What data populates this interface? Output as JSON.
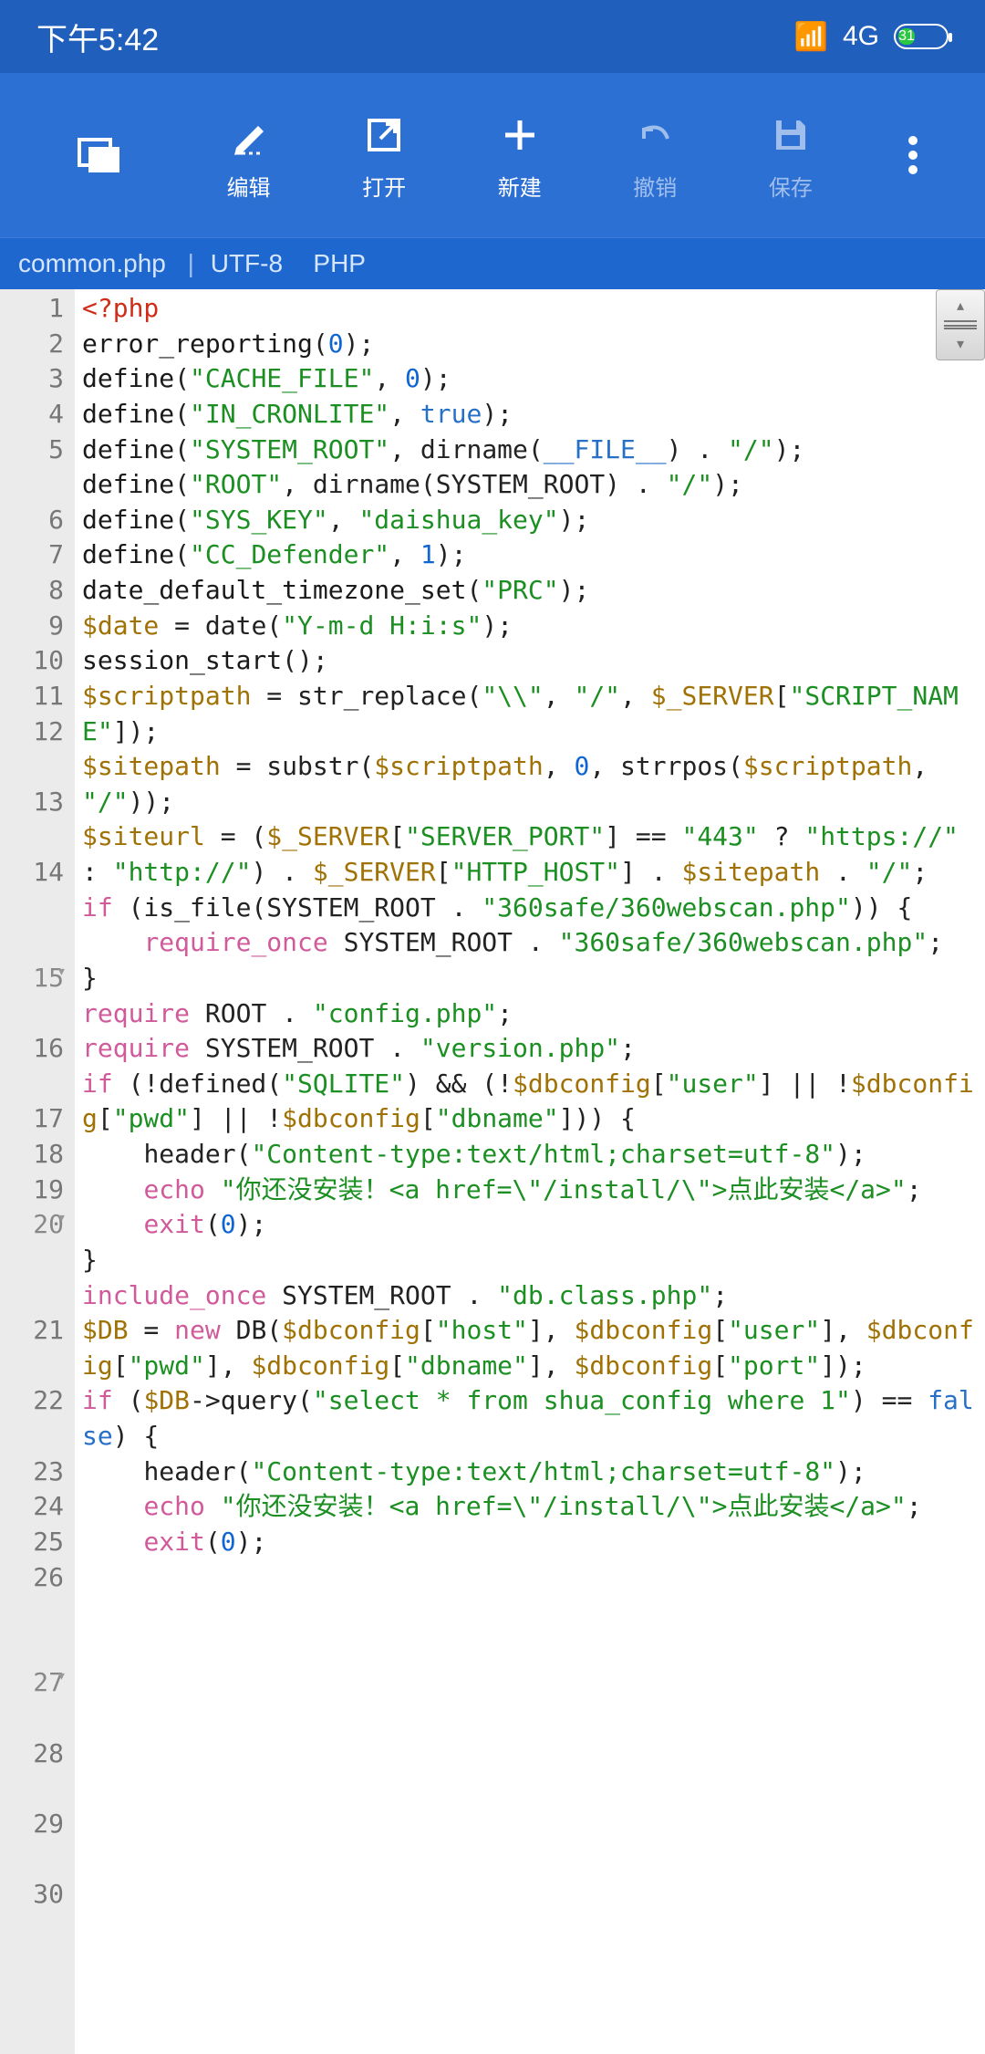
{
  "status": {
    "time": "下午5:42",
    "network": "4G",
    "battery_pct": "31"
  },
  "toolbar": {
    "edit": "编辑",
    "open": "打开",
    "new": "新建",
    "undo": "撤销",
    "save": "保存"
  },
  "filebar": {
    "filename": "common.php",
    "encoding": "UTF-8",
    "lang": "PHP"
  },
  "gutter_lines": [
    "1",
    "2",
    "3",
    "4",
    "5",
    "",
    "6",
    "7",
    "8",
    "9",
    "10",
    "11",
    "12",
    "",
    "13",
    "",
    "14",
    "",
    "",
    "15",
    "",
    "16",
    "",
    "17",
    "18",
    "19",
    "20",
    "",
    "",
    "21",
    "",
    "22",
    "",
    "23",
    "24",
    "25",
    "26",
    "",
    "",
    "27",
    "",
    "28",
    "",
    "29",
    "",
    "30"
  ],
  "fold_lines": [
    "15",
    "20",
    "27"
  ],
  "code_tokens": [
    [
      {
        "c": "tag",
        "t": "<?php"
      }
    ],
    [
      {
        "c": "fn",
        "t": "error_reporting"
      },
      {
        "c": "punc",
        "t": "("
      },
      {
        "c": "num",
        "t": "0"
      },
      {
        "c": "punc",
        "t": ");"
      }
    ],
    [
      {
        "c": "fn",
        "t": "define"
      },
      {
        "c": "punc",
        "t": "("
      },
      {
        "c": "str",
        "t": "\"CACHE_FILE\""
      },
      {
        "c": "punc",
        "t": ", "
      },
      {
        "c": "num",
        "t": "0"
      },
      {
        "c": "punc",
        "t": ");"
      }
    ],
    [
      {
        "c": "fn",
        "t": "define"
      },
      {
        "c": "punc",
        "t": "("
      },
      {
        "c": "str",
        "t": "\"IN_CRONLITE\""
      },
      {
        "c": "punc",
        "t": ", "
      },
      {
        "c": "bool",
        "t": "true"
      },
      {
        "c": "punc",
        "t": ");"
      }
    ],
    [
      {
        "c": "fn",
        "t": "define"
      },
      {
        "c": "punc",
        "t": "("
      },
      {
        "c": "str",
        "t": "\"SYSTEM_ROOT\""
      },
      {
        "c": "punc",
        "t": ", dirname("
      },
      {
        "c": "def",
        "t": "__FILE__"
      },
      {
        "c": "punc",
        "t": ") . "
      },
      {
        "c": "str",
        "t": "\"/\""
      },
      {
        "c": "punc",
        "t": ");"
      }
    ],
    [
      {
        "c": "fn",
        "t": "define"
      },
      {
        "c": "punc",
        "t": "("
      },
      {
        "c": "str",
        "t": "\"ROOT\""
      },
      {
        "c": "punc",
        "t": ", dirname(SYSTEM_ROOT) . "
      },
      {
        "c": "str",
        "t": "\"/\""
      },
      {
        "c": "punc",
        "t": ");"
      }
    ],
    [
      {
        "c": "fn",
        "t": "define"
      },
      {
        "c": "punc",
        "t": "("
      },
      {
        "c": "str",
        "t": "\"SYS_KEY\""
      },
      {
        "c": "punc",
        "t": ", "
      },
      {
        "c": "str",
        "t": "\"daishua_key\""
      },
      {
        "c": "punc",
        "t": ");"
      }
    ],
    [
      {
        "c": "fn",
        "t": "define"
      },
      {
        "c": "punc",
        "t": "("
      },
      {
        "c": "str",
        "t": "\"CC_Defender\""
      },
      {
        "c": "punc",
        "t": ", "
      },
      {
        "c": "num",
        "t": "1"
      },
      {
        "c": "punc",
        "t": ");"
      }
    ],
    [
      {
        "c": "fn",
        "t": "date_default_timezone_set"
      },
      {
        "c": "punc",
        "t": "("
      },
      {
        "c": "str",
        "t": "\"PRC\""
      },
      {
        "c": "punc",
        "t": ");"
      }
    ],
    [
      {
        "c": "var",
        "t": "$date"
      },
      {
        "c": "punc",
        "t": " = date("
      },
      {
        "c": "str",
        "t": "\"Y-m-d H:i:s\""
      },
      {
        "c": "punc",
        "t": ");"
      }
    ],
    [
      {
        "c": "fn",
        "t": "session_start"
      },
      {
        "c": "punc",
        "t": "();"
      }
    ],
    [
      {
        "c": "var",
        "t": "$scriptpath"
      },
      {
        "c": "punc",
        "t": " = str_replace("
      },
      {
        "c": "str",
        "t": "\"\\\\\""
      },
      {
        "c": "punc",
        "t": ", "
      },
      {
        "c": "str",
        "t": "\"/\""
      },
      {
        "c": "punc",
        "t": ", "
      },
      {
        "c": "var",
        "t": "$_SERVER"
      },
      {
        "c": "punc",
        "t": "["
      },
      {
        "c": "str",
        "t": "\"SCRIPT_NAME\""
      },
      {
        "c": "punc",
        "t": "]);"
      }
    ],
    [
      {
        "c": "var",
        "t": "$sitepath"
      },
      {
        "c": "punc",
        "t": " = substr("
      },
      {
        "c": "var",
        "t": "$scriptpath"
      },
      {
        "c": "punc",
        "t": ", "
      },
      {
        "c": "num",
        "t": "0"
      },
      {
        "c": "punc",
        "t": ", strrpos("
      },
      {
        "c": "var",
        "t": "$scriptpath"
      },
      {
        "c": "punc",
        "t": ", "
      },
      {
        "c": "str",
        "t": "\"/\""
      },
      {
        "c": "punc",
        "t": "));"
      }
    ],
    [
      {
        "c": "var",
        "t": "$siteurl"
      },
      {
        "c": "punc",
        "t": " = ("
      },
      {
        "c": "var",
        "t": "$_SERVER"
      },
      {
        "c": "punc",
        "t": "["
      },
      {
        "c": "str",
        "t": "\"SERVER_PORT\""
      },
      {
        "c": "punc",
        "t": "] == "
      },
      {
        "c": "str",
        "t": "\"443\""
      },
      {
        "c": "punc",
        "t": " ? "
      },
      {
        "c": "str",
        "t": "\"https://\""
      },
      {
        "c": "punc",
        "t": " : "
      },
      {
        "c": "str",
        "t": "\"http://\""
      },
      {
        "c": "punc",
        "t": ") . "
      },
      {
        "c": "var",
        "t": "$_SERVER"
      },
      {
        "c": "punc",
        "t": "["
      },
      {
        "c": "str",
        "t": "\"HTTP_HOST\""
      },
      {
        "c": "punc",
        "t": "] . "
      },
      {
        "c": "var",
        "t": "$sitepath"
      },
      {
        "c": "punc",
        "t": " . "
      },
      {
        "c": "str",
        "t": "\"/\""
      },
      {
        "c": "punc",
        "t": ";"
      }
    ],
    [
      {
        "c": "kw",
        "t": "if"
      },
      {
        "c": "punc",
        "t": " (is_file(SYSTEM_ROOT . "
      },
      {
        "c": "str",
        "t": "\"360safe/360webscan.php\""
      },
      {
        "c": "punc",
        "t": ")) {"
      }
    ],
    [
      {
        "c": "punc",
        "t": "    "
      },
      {
        "c": "kw",
        "t": "require_once"
      },
      {
        "c": "punc",
        "t": " SYSTEM_ROOT . "
      },
      {
        "c": "str",
        "t": "\"360safe/360webscan.php\""
      },
      {
        "c": "punc",
        "t": ";"
      }
    ],
    [
      {
        "c": "punc",
        "t": "}"
      }
    ],
    [
      {
        "c": "kw",
        "t": "require"
      },
      {
        "c": "punc",
        "t": " ROOT . "
      },
      {
        "c": "str",
        "t": "\"config.php\""
      },
      {
        "c": "punc",
        "t": ";"
      }
    ],
    [
      {
        "c": "kw",
        "t": "require"
      },
      {
        "c": "punc",
        "t": " SYSTEM_ROOT . "
      },
      {
        "c": "str",
        "t": "\"version.php\""
      },
      {
        "c": "punc",
        "t": ";"
      }
    ],
    [
      {
        "c": "kw",
        "t": "if"
      },
      {
        "c": "punc",
        "t": " (!defined("
      },
      {
        "c": "str",
        "t": "\"SQLITE\""
      },
      {
        "c": "punc",
        "t": ") && (!"
      },
      {
        "c": "var",
        "t": "$dbconfig"
      },
      {
        "c": "punc",
        "t": "["
      },
      {
        "c": "str",
        "t": "\"user\""
      },
      {
        "c": "punc",
        "t": "] || !"
      },
      {
        "c": "var",
        "t": "$dbconfig"
      },
      {
        "c": "punc",
        "t": "["
      },
      {
        "c": "str",
        "t": "\"pwd\""
      },
      {
        "c": "punc",
        "t": "] || !"
      },
      {
        "c": "var",
        "t": "$dbconfig"
      },
      {
        "c": "punc",
        "t": "["
      },
      {
        "c": "str",
        "t": "\"dbname\""
      },
      {
        "c": "punc",
        "t": "])) {"
      }
    ],
    [
      {
        "c": "punc",
        "t": "    header("
      },
      {
        "c": "str",
        "t": "\"Content-type:text/html;charset=utf-8\""
      },
      {
        "c": "punc",
        "t": ");"
      }
    ],
    [
      {
        "c": "punc",
        "t": "    "
      },
      {
        "c": "kw",
        "t": "echo"
      },
      {
        "c": "punc",
        "t": " "
      },
      {
        "c": "str",
        "t": "\"你还没安装！<a href=\\\"/install/\\\">点此安装</a>\""
      },
      {
        "c": "punc",
        "t": ";"
      }
    ],
    [
      {
        "c": "punc",
        "t": "    "
      },
      {
        "c": "kw",
        "t": "exit"
      },
      {
        "c": "punc",
        "t": "("
      },
      {
        "c": "num",
        "t": "0"
      },
      {
        "c": "punc",
        "t": ");"
      }
    ],
    [
      {
        "c": "punc",
        "t": "}"
      }
    ],
    [
      {
        "c": "kw",
        "t": "include_once"
      },
      {
        "c": "punc",
        "t": " SYSTEM_ROOT . "
      },
      {
        "c": "str",
        "t": "\"db.class.php\""
      },
      {
        "c": "punc",
        "t": ";"
      }
    ],
    [
      {
        "c": "var",
        "t": "$DB"
      },
      {
        "c": "punc",
        "t": " = "
      },
      {
        "c": "kw",
        "t": "new"
      },
      {
        "c": "punc",
        "t": " DB("
      },
      {
        "c": "var",
        "t": "$dbconfig"
      },
      {
        "c": "punc",
        "t": "["
      },
      {
        "c": "str",
        "t": "\"host\""
      },
      {
        "c": "punc",
        "t": "], "
      },
      {
        "c": "var",
        "t": "$dbconfig"
      },
      {
        "c": "punc",
        "t": "["
      },
      {
        "c": "str",
        "t": "\"user\""
      },
      {
        "c": "punc",
        "t": "], "
      },
      {
        "c": "var",
        "t": "$dbconfig"
      },
      {
        "c": "punc",
        "t": "["
      },
      {
        "c": "str",
        "t": "\"pwd\""
      },
      {
        "c": "punc",
        "t": "], "
      },
      {
        "c": "var",
        "t": "$dbconfig"
      },
      {
        "c": "punc",
        "t": "["
      },
      {
        "c": "str",
        "t": "\"dbname\""
      },
      {
        "c": "punc",
        "t": "], "
      },
      {
        "c": "var",
        "t": "$dbconfig"
      },
      {
        "c": "punc",
        "t": "["
      },
      {
        "c": "str",
        "t": "\"port\""
      },
      {
        "c": "punc",
        "t": "]);"
      }
    ],
    [
      {
        "c": "kw",
        "t": "if"
      },
      {
        "c": "punc",
        "t": " ("
      },
      {
        "c": "var",
        "t": "$DB"
      },
      {
        "c": "punc",
        "t": "->query("
      },
      {
        "c": "str",
        "t": "\"select * from shua_config where 1\""
      },
      {
        "c": "punc",
        "t": ") == "
      },
      {
        "c": "bool",
        "t": "false"
      },
      {
        "c": "punc",
        "t": ") {"
      }
    ],
    [
      {
        "c": "punc",
        "t": "    header("
      },
      {
        "c": "str",
        "t": "\"Content-type:text/html;charset=utf-8\""
      },
      {
        "c": "punc",
        "t": ");"
      }
    ],
    [
      {
        "c": "punc",
        "t": "    "
      },
      {
        "c": "kw",
        "t": "echo"
      },
      {
        "c": "punc",
        "t": " "
      },
      {
        "c": "str",
        "t": "\"你还没安装！<a href=\\\"/install/\\\">点此安装</a>\""
      },
      {
        "c": "punc",
        "t": ";"
      }
    ],
    [
      {
        "c": "punc",
        "t": "    "
      },
      {
        "c": "kw",
        "t": "exit"
      },
      {
        "c": "punc",
        "t": "("
      },
      {
        "c": "num",
        "t": "0"
      },
      {
        "c": "punc",
        "t": ");"
      }
    ]
  ]
}
